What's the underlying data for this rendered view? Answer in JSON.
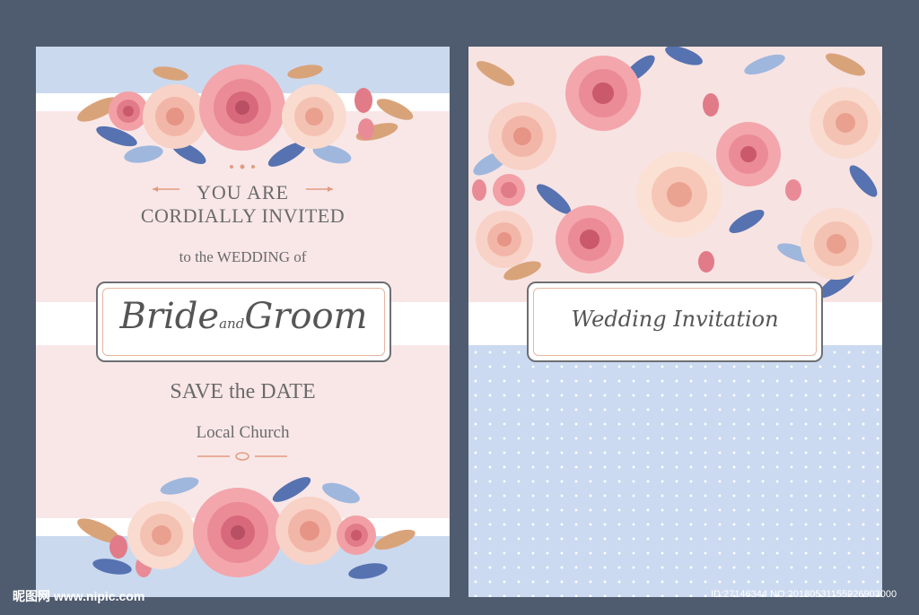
{
  "left_card": {
    "line1": "YOU ARE",
    "line2": "CORDIALLY INVITED",
    "line3": "to the WEDDING of",
    "names_main1": "Bride",
    "names_and": "and",
    "names_main2": "Groom",
    "save_date": "SAVE the DATE",
    "location": "Local Church"
  },
  "right_card": {
    "title": "Wedding Invitation"
  },
  "watermark": {
    "left": "昵图网 www.nipic.com",
    "right": "ID:27146344 NO:20180531155926903000"
  },
  "colors": {
    "background": "#4f5b6e",
    "blush": "#fbe9ea",
    "powder_blue": "#cbd9ee",
    "rose": "#e98b97",
    "peach": "#f6c3b4",
    "leaf_blue": "#5672b0",
    "leaf_gold": "#d9a37a",
    "text_gray": "#6a6a6a",
    "frame_gray": "#6d6f73"
  }
}
